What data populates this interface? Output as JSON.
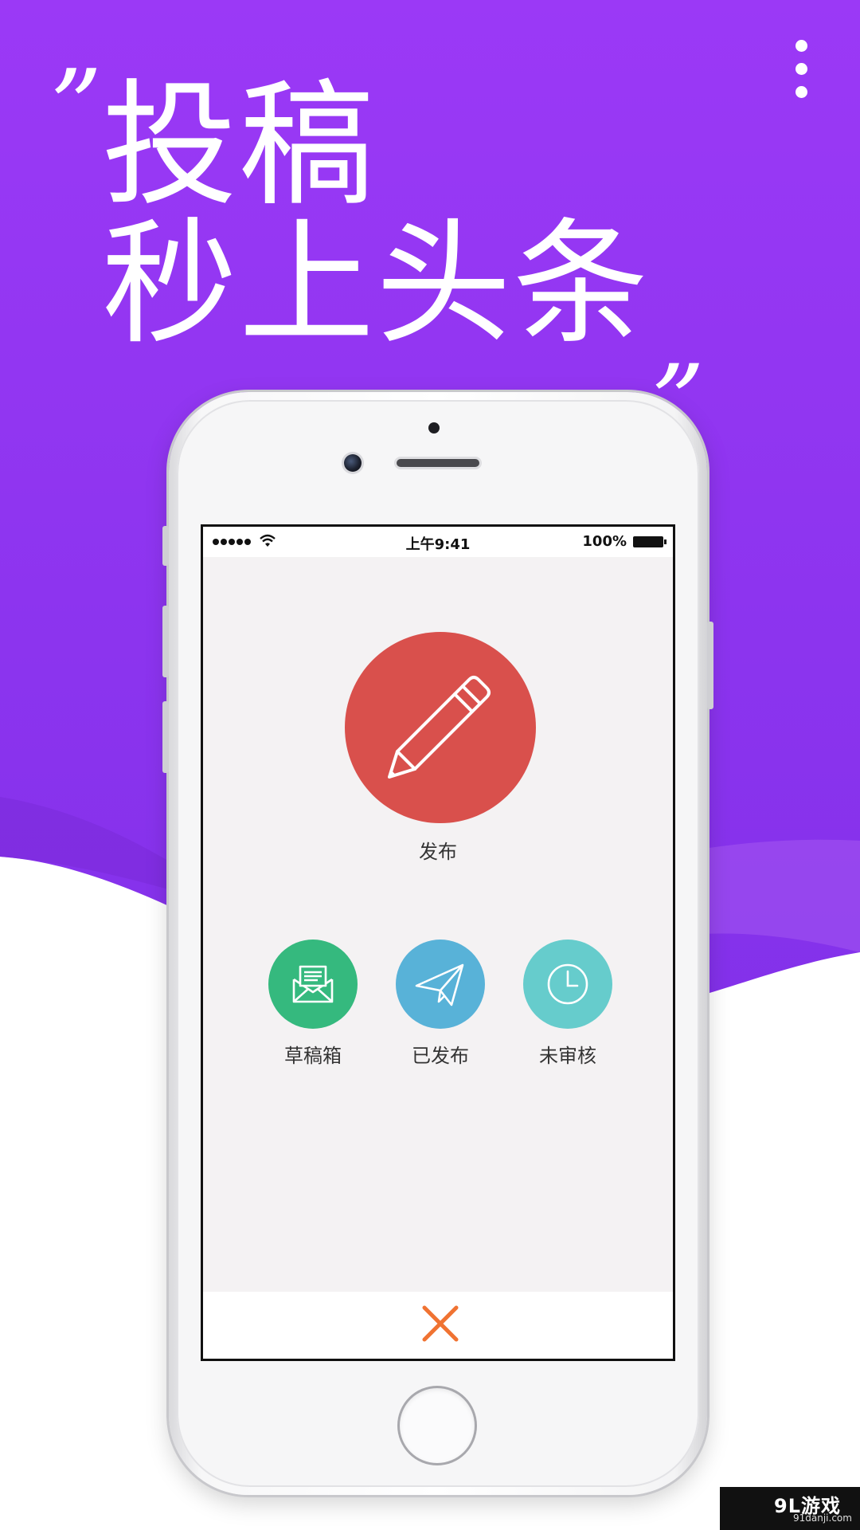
{
  "headline": {
    "quote_open": "”",
    "line1": "投稿",
    "line2": "秒上头条",
    "quote_close": "„"
  },
  "menu": {
    "icon": "more-vertical-icon"
  },
  "status_bar": {
    "signal_icon": "signal-dots-icon",
    "wifi_icon": "wifi-icon",
    "time": "上午9:41",
    "battery_percent": "100%",
    "battery_icon": "battery-full-icon"
  },
  "screen": {
    "publish": {
      "label": "发布",
      "icon": "pencil-icon",
      "color": "#d9504c"
    },
    "actions": [
      {
        "label": "草稿箱",
        "icon": "envelope-open-icon",
        "color": "#35b97e"
      },
      {
        "label": "已发布",
        "icon": "paper-plane-icon",
        "color": "#58b2d8"
      },
      {
        "label": "未审核",
        "icon": "clock-icon",
        "color": "#66cccc"
      }
    ],
    "close_icon": "close-icon",
    "close_color": "#f07332"
  },
  "colors": {
    "purple_top": "#9b39f6",
    "purple_bottom": "#7d2ee5",
    "screen_background": "#f4f2f3"
  },
  "watermark": {
    "logo": "9L游戏",
    "url": "91danji.com"
  }
}
